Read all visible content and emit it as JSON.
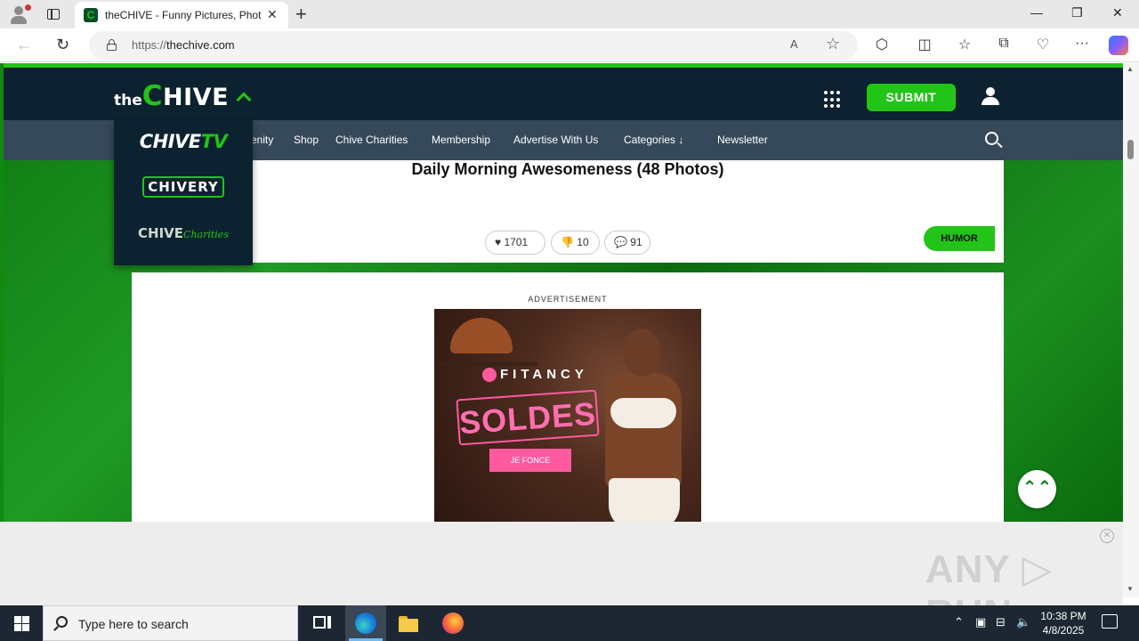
{
  "browser": {
    "tab_title": "theCHIVE - Funny Pictures, Photos",
    "favicon_letter": "C",
    "new_tab_symbol": "+",
    "tab_close_symbol": "✕",
    "url_prefix": "https://",
    "url_host": "thechive.com",
    "read_aloud_symbol": "A",
    "favorite_symbol": "☆",
    "window_controls": {
      "minimize": "—",
      "restore": "❐",
      "close": "✕"
    },
    "nav": {
      "back": "←",
      "refresh": "↻"
    },
    "toolbar_icons": [
      "extensions-icon",
      "split-screen-icon",
      "favorites-icon",
      "collections-icon",
      "browser-essentials-icon",
      "more-icon",
      "copilot-icon"
    ],
    "toolbar_symbols": {
      "extensions": "⬡",
      "split": "◫",
      "favorites": "☆",
      "collections": "⧉",
      "essentials": "♡",
      "more": "···"
    }
  },
  "site": {
    "logo": {
      "the": "the",
      "c": "C",
      "rest": "HIVE"
    },
    "submit_label": "SUBMIT",
    "nav_items": [
      "enity",
      "Shop",
      "Chive Charities",
      "Membership",
      "Advertise With Us",
      "Categories",
      "Newsletter"
    ],
    "categories_arrow": "↓",
    "dropdown": {
      "chivetv_a": "CHIVE",
      "chivetv_b": "TV",
      "chivery": "CHIVERY",
      "charities_a": "CHIVE",
      "charities_b": "Charities"
    },
    "article": {
      "title": "Daily Morning Awesomeness (48 Photos)",
      "likes": "1701",
      "dislikes": "10",
      "comments": "91",
      "tag": "HUMOR",
      "like_symbol": "♥",
      "dislike_symbol": "👎",
      "comment_symbol": "💬"
    },
    "ad": {
      "label": "ADVERTISEMENT",
      "brand": "FITANCY",
      "headline": "SOLDES",
      "cta": "JE FONCE"
    },
    "scroll_top_symbol": "⌃⌃"
  },
  "overlay": {
    "close_symbol": "✕",
    "watermark": "ANY ▷ RUN"
  },
  "taskbar": {
    "search_placeholder": "Type here to search",
    "time": "10:38 PM",
    "date": "4/8/2025",
    "tray": {
      "chevron": "⌃",
      "monitor": "▣",
      "network": "⊟",
      "volume": "🔈"
    }
  },
  "colors": {
    "brand_green": "#21c417",
    "header_navy": "#0c2230",
    "nav_slate": "#36495a",
    "ad_pink": "#ff5aa0"
  }
}
